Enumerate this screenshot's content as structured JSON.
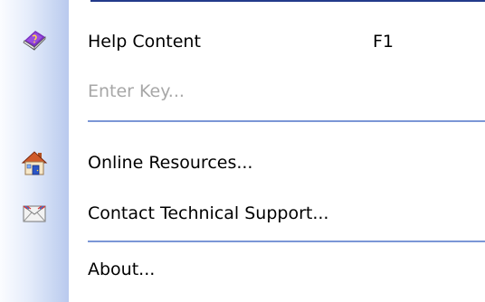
{
  "menu": {
    "items": [
      {
        "label": "Help Content",
        "shortcut": "F1",
        "icon": "help-book-icon",
        "enabled": true
      },
      {
        "label": "Enter Key...",
        "shortcut": "",
        "icon": "",
        "enabled": false
      },
      {
        "label": "Online Resources...",
        "shortcut": "",
        "icon": "home-icon",
        "enabled": true
      },
      {
        "label": "Contact Technical Support...",
        "shortcut": "",
        "icon": "envelope-icon",
        "enabled": true
      },
      {
        "label": "About...",
        "shortcut": "",
        "icon": "",
        "enabled": true
      }
    ]
  },
  "colors": {
    "gutter_start": "#fbfcff",
    "gutter_end": "#b9c9ee",
    "separator": "#7b96d6",
    "disabled_text": "#a7a7a7",
    "top_border": "#223a8a"
  }
}
